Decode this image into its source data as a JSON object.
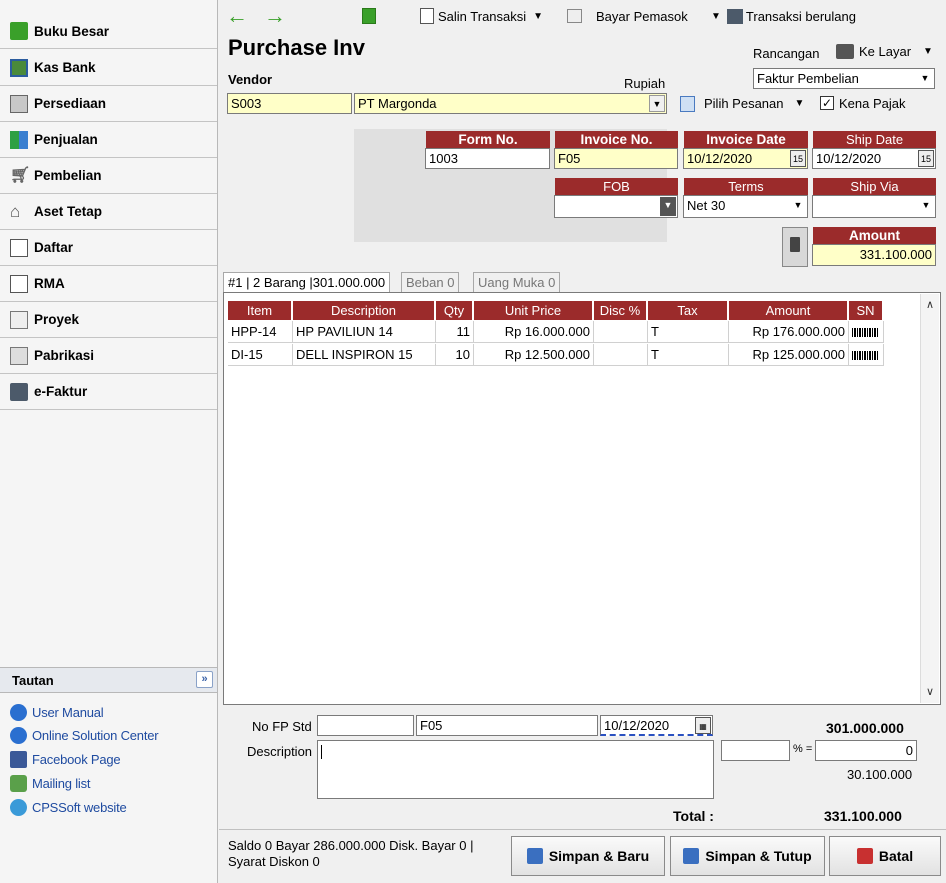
{
  "sidebar": {
    "items": [
      {
        "label": "Buku Besar",
        "icon": "ledger-icon"
      },
      {
        "label": "Kas Bank",
        "icon": "bank-icon"
      },
      {
        "label": "Persediaan",
        "icon": "inventory-icon"
      },
      {
        "label": "Penjualan",
        "icon": "sales-icon"
      },
      {
        "label": "Pembelian",
        "icon": "cart-icon"
      },
      {
        "label": "Aset Tetap",
        "icon": "house-icon"
      },
      {
        "label": "Daftar",
        "icon": "list-icon"
      },
      {
        "label": "RMA",
        "icon": "rma-icon"
      },
      {
        "label": "Proyek",
        "icon": "project-icon"
      },
      {
        "label": "Pabrikasi",
        "icon": "factory-icon"
      },
      {
        "label": "e-Faktur",
        "icon": "efaktur-icon"
      }
    ],
    "tautan": {
      "title": "Tautan",
      "links": [
        "User Manual",
        "Online Solution Center",
        "Facebook Page",
        "Mailing list",
        "CPSSoft website"
      ]
    }
  },
  "toolbar": {
    "copy_transaction": "Salin Transaksi",
    "pay_supplier": "Bayar Pemasok",
    "recurring": "Transaksi berulang"
  },
  "form": {
    "title": "Purchase Inv",
    "design_label": "Rancangan",
    "print_target": "Ke Layar",
    "design_value": "Faktur Pembelian",
    "vendor_label": "Vendor",
    "currency": "Rupiah",
    "vendor_code": "S003",
    "vendor_name": "PT Margonda",
    "choose_order": "Pilih Pesanan",
    "taxable_label": "Kena Pajak",
    "taxable": true,
    "form_no_label": "Form No.",
    "form_no": "1003",
    "invoice_no_label": "Invoice No.",
    "invoice_no": "F05",
    "invoice_date_label": "Invoice Date",
    "invoice_date": "10/12/2020",
    "ship_date_label": "Ship Date",
    "ship_date": "10/12/2020",
    "fob_label": "FOB",
    "fob": "",
    "terms_label": "Terms",
    "terms": "Net 30",
    "ship_via_label": "Ship Via",
    "ship_via": "",
    "amount_label": "Amount",
    "amount": "331.100.000",
    "calendar_glyph": "15"
  },
  "tabs": [
    {
      "label": "#1 | 2 Barang |301.000.000",
      "active": true
    },
    {
      "label": "Beban   0",
      "active": false
    },
    {
      "label": "Uang Muka   0",
      "active": false
    }
  ],
  "grid": {
    "headers": [
      "Item",
      "Description",
      "Qty",
      "Unit Price",
      "Disc %",
      "Tax",
      "Amount",
      "SN"
    ],
    "rows": [
      {
        "item": "HPP-14",
        "description": "HP PAVILIUN 14",
        "qty": "11",
        "unit_price": "Rp 16.000.000",
        "disc": "",
        "tax": "T",
        "amount": "Rp 176.000.000"
      },
      {
        "item": "DI-15",
        "description": "DELL INSPIRON 15",
        "qty": "10",
        "unit_price": "Rp 12.500.000",
        "disc": "",
        "tax": "T",
        "amount": "Rp 125.000.000"
      }
    ]
  },
  "footer": {
    "no_fp_label": "No FP Std",
    "no_fp_value": "",
    "fp_invoice": "F05",
    "fp_date": "10/12/2020",
    "description_label": "Description",
    "description": "",
    "subtotal": "301.000.000",
    "discount_percent": "",
    "percent_eq": "% =",
    "discount_amount": "0",
    "tax_amount": "30.100.000",
    "total_label": "Total :",
    "total": "331.100.000"
  },
  "status": {
    "line1": "Saldo 0   Bayar 286.000.000   Disk. Bayar 0   |",
    "line2": "Syarat Diskon 0"
  },
  "buttons": {
    "save_new": "Simpan & Baru",
    "save_close": "Simpan & Tutup",
    "cancel": "Batal"
  }
}
